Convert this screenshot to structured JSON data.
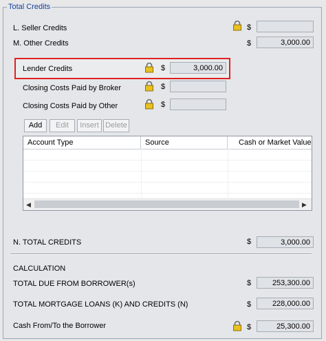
{
  "group": {
    "title": "Total Credits"
  },
  "currency_symbol": "$",
  "rows": {
    "seller_credits": {
      "label": "L. Seller Credits",
      "value": ""
    },
    "other_credits": {
      "label": "M. Other Credits",
      "value": "3,000.00"
    },
    "lender_credits": {
      "label": "Lender Credits",
      "value": "3,000.00"
    },
    "broker_costs": {
      "label": "Closing Costs Paid by Broker",
      "value": ""
    },
    "other_costs": {
      "label": "Closing Costs Paid by Other",
      "value": ""
    },
    "total_credits": {
      "label": "N. TOTAL CREDITS",
      "value": "3,000.00"
    }
  },
  "toolbar": {
    "add": "Add",
    "edit": "Edit",
    "insert": "Insert",
    "delete": "Delete"
  },
  "grid": {
    "columns": [
      "Account Type",
      "Source",
      "Cash or Market Value"
    ]
  },
  "calculation": {
    "title": "CALCULATION",
    "total_due": {
      "label": "TOTAL DUE FROM BORROWER(s)",
      "value": "253,300.00"
    },
    "total_mortgage": {
      "label": "TOTAL MORTGAGE LOANS (K) AND CREDITS (N)",
      "value": "228,000.00"
    },
    "cash_from_to": {
      "label": "Cash From/To the Borrower",
      "value": "25,300.00"
    }
  },
  "colors": {
    "highlight": "#e02020",
    "group_title": "#1a3f9c",
    "lock": "#e8c020"
  }
}
